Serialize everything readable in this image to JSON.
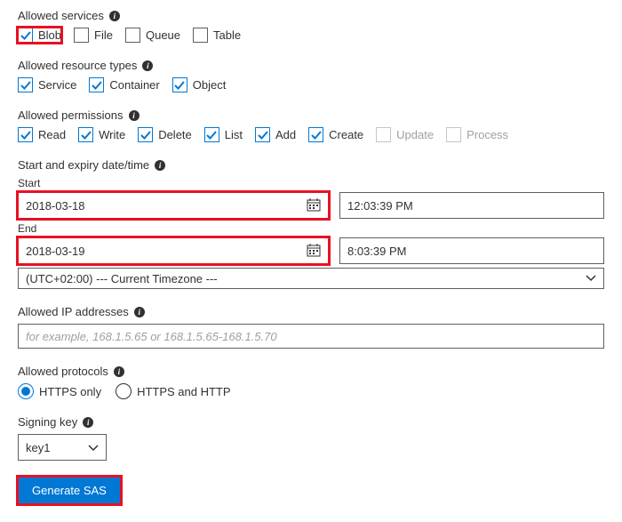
{
  "services": {
    "label": "Allowed services",
    "options": {
      "blob": {
        "label": "Blob",
        "checked": true,
        "disabled": false,
        "highlight": true
      },
      "file": {
        "label": "File",
        "checked": false,
        "disabled": false,
        "highlight": false
      },
      "queue": {
        "label": "Queue",
        "checked": false,
        "disabled": false,
        "highlight": false
      },
      "table": {
        "label": "Table",
        "checked": false,
        "disabled": false,
        "highlight": false
      }
    }
  },
  "resource_types": {
    "label": "Allowed resource types",
    "options": {
      "service": {
        "label": "Service",
        "checked": true
      },
      "container": {
        "label": "Container",
        "checked": true
      },
      "object": {
        "label": "Object",
        "checked": true
      }
    }
  },
  "permissions": {
    "label": "Allowed permissions",
    "options": {
      "read": {
        "label": "Read",
        "checked": true,
        "disabled": false
      },
      "write": {
        "label": "Write",
        "checked": true,
        "disabled": false
      },
      "delete": {
        "label": "Delete",
        "checked": true,
        "disabled": false
      },
      "list": {
        "label": "List",
        "checked": true,
        "disabled": false
      },
      "add": {
        "label": "Add",
        "checked": true,
        "disabled": false
      },
      "create": {
        "label": "Create",
        "checked": true,
        "disabled": false
      },
      "update": {
        "label": "Update",
        "checked": false,
        "disabled": true
      },
      "process": {
        "label": "Process",
        "checked": false,
        "disabled": true
      }
    }
  },
  "datetime": {
    "label": "Start and expiry date/time",
    "start_label": "Start",
    "end_label": "End",
    "start_date": "2018-03-18",
    "start_time": "12:03:39 PM",
    "end_date": "2018-03-19",
    "end_time": "8:03:39 PM",
    "timezone": "(UTC+02:00) --- Current Timezone ---"
  },
  "ip": {
    "label": "Allowed IP addresses",
    "placeholder": "for example, 168.1.5.65 or 168.1.5.65-168.1.5.70",
    "value": ""
  },
  "protocols": {
    "label": "Allowed protocols",
    "https_only": "HTTPS only",
    "https_http": "HTTPS and HTTP",
    "selected": "https_only"
  },
  "signing_key": {
    "label": "Signing key",
    "value": "key1"
  },
  "generate_button": "Generate SAS"
}
